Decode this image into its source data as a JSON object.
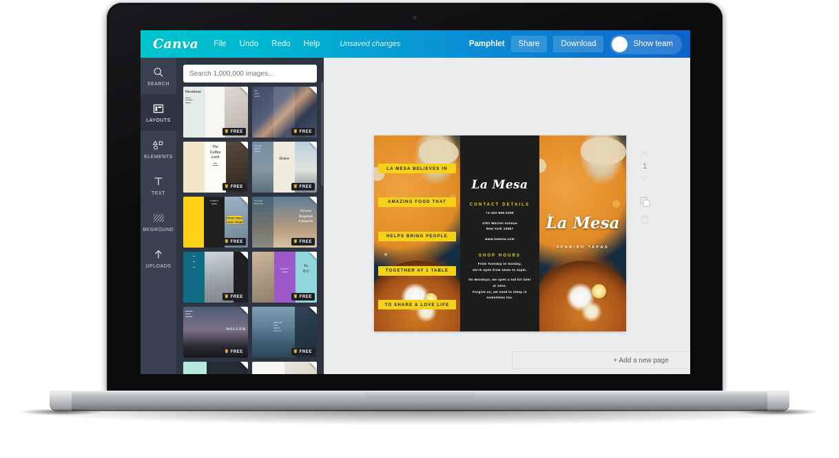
{
  "app": {
    "brand": "Canva",
    "menu": [
      "File",
      "Undo",
      "Redo",
      "Help"
    ],
    "status_text": "Unsaved changes",
    "doc_title": "Pamphlet",
    "share_label": "Share",
    "download_label": "Download",
    "team_label": "Show team",
    "accent_gradient_start": "#00c4cc",
    "accent_gradient_end": "#0d63c9"
  },
  "rail": {
    "items": [
      {
        "label": "SEARCH",
        "icon": "search-icon",
        "active": false
      },
      {
        "label": "LAYOUTS",
        "icon": "layouts-icon",
        "active": true
      },
      {
        "label": "ELEMENTS",
        "icon": "elements-icon",
        "active": false
      },
      {
        "label": "TEXT",
        "icon": "text-icon",
        "active": false
      },
      {
        "label": "BKGROUND",
        "icon": "background-icon",
        "active": false
      },
      {
        "label": "UPLOADS",
        "icon": "upload-icon",
        "active": false
      }
    ]
  },
  "search": {
    "placeholder": "Search 1,000,000 images...",
    "value": ""
  },
  "templates": {
    "badge_label": "FREE",
    "items": [
      {
        "id": 1,
        "title": "Hermione Webb",
        "theme": "minimal-coffee"
      },
      {
        "id": 2,
        "title": "nora + smith",
        "theme": "geometric-navy"
      },
      {
        "id": 3,
        "title": "The Coffee Lord",
        "theme": "cream-cafe"
      },
      {
        "id": 4,
        "title": "Grace",
        "theme": "mountain-pastel"
      },
      {
        "id": 5,
        "title": "Home loans made simple",
        "theme": "yellow-black"
      },
      {
        "id": 6,
        "title": "Grace Baptist Church",
        "theme": "sky-church"
      },
      {
        "id": 7,
        "title": "THE BASTION",
        "theme": "teal-truck"
      },
      {
        "id": 8,
        "title": "hi, D C",
        "theme": "purple-desk"
      },
      {
        "id": 9,
        "title": "MILLER",
        "theme": "dusk-landscape"
      },
      {
        "id": 10,
        "title": "EXPLORE THE WORLD WITH US",
        "theme": "lake-explorer"
      },
      {
        "id": 11,
        "title": "",
        "theme": "mint-dark"
      },
      {
        "id": 12,
        "title": "",
        "theme": "interior-light"
      }
    ]
  },
  "design": {
    "left_panel": {
      "strips": [
        "LA MESA BELIEVES IN",
        "AMAZING FOOD THAT",
        "HELPS BRING PEOPLE",
        "TOGETHER AT 1 TABLE",
        "TO SHARE & LOVE LIFE"
      ],
      "strip_color": "#f5d21a"
    },
    "middle_panel": {
      "brand": "La Mesa",
      "contact_heading": "CONTACT DETAILS",
      "phone": "+1-202-555-0195",
      "address_line1": "1201 Warren Avenue",
      "address_line2": "New York 10987",
      "website": "www.lamesa.com",
      "hours_heading": "SHOP HOURS",
      "hours_line1": "From Tuesday to Sunday,",
      "hours_line2": "we're open from 10am to 11pm.",
      "hours_line3": "On Mondays, we open a tad bit later at 12nn.",
      "hours_line4": "Forgive us, we need to sleep in sometimes too.",
      "heading_color": "#f5d21a",
      "background_color": "#1d1d1d"
    },
    "right_panel": {
      "title": "La Mesa",
      "subtitle": "SPANISH TAPAS"
    }
  },
  "page_controls": {
    "up_icon": "chevron-up-icon",
    "page_number": "1",
    "down_icon": "chevron-down-icon",
    "duplicate_icon": "duplicate-page-icon",
    "delete_icon": "trash-icon"
  },
  "footer": {
    "add_page_label": "+ Add a new page"
  }
}
